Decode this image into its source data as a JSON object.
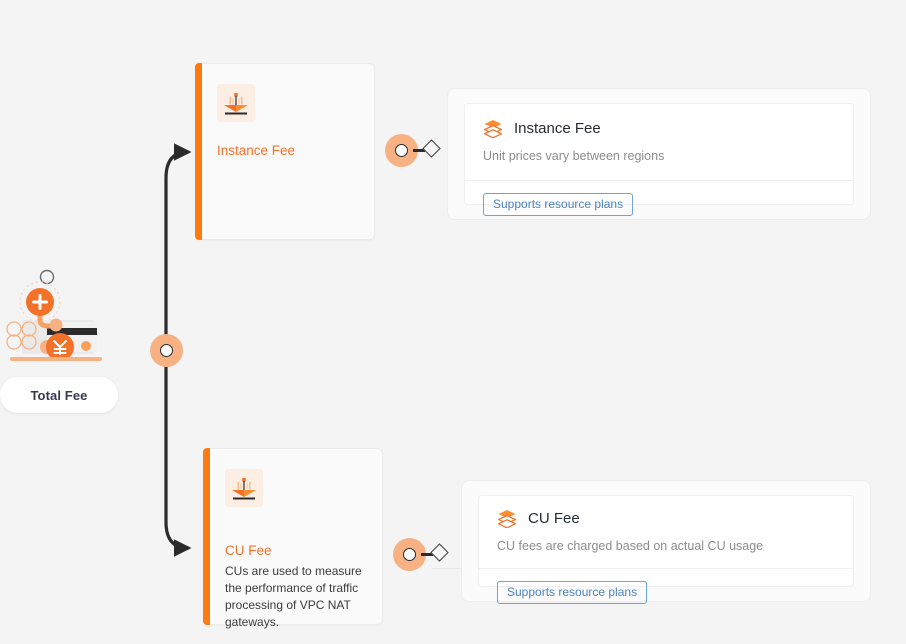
{
  "diagram": {
    "root": {
      "label": "Total Fee",
      "illustration_icon": "payment-card-illustration"
    },
    "accent_color": "#ff7a10",
    "node_halo_color": "#f7b183",
    "tag_color": "#4a83c4",
    "background_color": "#f4f4f4",
    "branches": [
      {
        "id": "instance-fee",
        "card": {
          "title": "Instance Fee",
          "icon": "instance-fee-illustration",
          "description": ""
        },
        "detail": {
          "icon": "layers-icon",
          "title": "Instance Fee",
          "description": "Unit prices vary between regions",
          "tag": "Supports resource plans"
        }
      },
      {
        "id": "cu-fee",
        "card": {
          "title": "CU Fee",
          "icon": "cu-fee-illustration",
          "description": "CUs are used to measure the performance of traffic processing of VPC NAT gateways."
        },
        "detail": {
          "icon": "layers-icon",
          "title": "CU Fee",
          "description": "CU fees are charged based on actual CU usage",
          "tag": "Supports resource plans"
        }
      }
    ]
  }
}
